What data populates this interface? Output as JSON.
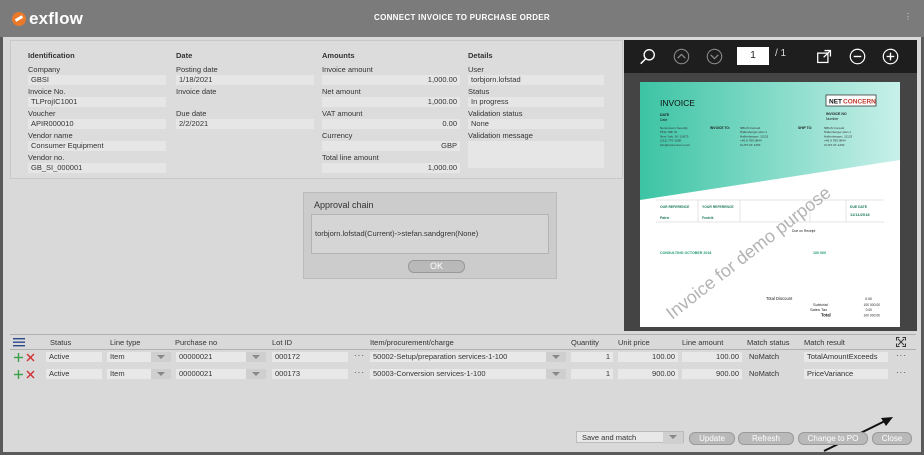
{
  "app": {
    "logo_text": "exflow",
    "title": "CONNECT INVOICE TO PURCHASE ORDER",
    "menu_glyph": "⋮"
  },
  "identification": {
    "header": "Identification",
    "company_label": "Company",
    "company": "GBSI",
    "invoice_no_label": "Invoice No.",
    "invoice_no": "TLProjIC1001",
    "voucher_label": "Voucher",
    "voucher": "APIR000010",
    "vendor_name_label": "Vendor name",
    "vendor_name": "Consumer Equipment",
    "vendor_no_label": "Vendor no.",
    "vendor_no": "GB_SI_000001"
  },
  "date": {
    "header": "Date",
    "posting_label": "Posting date",
    "posting": "1/18/2021",
    "invoice_label": "Invoice date",
    "invoice": "",
    "due_label": "Due date",
    "due": "2/2/2021"
  },
  "amounts": {
    "header": "Amounts",
    "invoice_amount_label": "Invoice amount",
    "invoice_amount": "1,000.00",
    "net_amount_label": "Net amount",
    "net_amount": "1,000.00",
    "vat_amount_label": "VAT amount",
    "vat_amount": "0.00",
    "currency_label": "Currency",
    "currency": "GBP",
    "total_line_label": "Total line amount",
    "total_line": "1,000.00"
  },
  "details": {
    "header": "Details",
    "user_label": "User",
    "user": "torbjorn.lofstad",
    "status_label": "Status",
    "status": "In progress",
    "validation_status_label": "Validation status",
    "validation_status": "None",
    "validation_message_label": "Validation message",
    "validation_message": ""
  },
  "approval": {
    "title": "Approval chain",
    "chain": "torbjorn.lofstad(Current)->stefan.sandgren(None)",
    "ok_label": "OK"
  },
  "viewer": {
    "page": "1",
    "page_total": "/ 1"
  },
  "invoice_doc": {
    "title": "INVOICE",
    "brand_a": "NET",
    "brand_b": "CONCERN",
    "invoice_no_label": "INVOICE NO",
    "number_label": "Number",
    "date_label": "DATE",
    "date_value": "Date",
    "from_lines": [
      "Netconcern Security",
      "55 E 78th St",
      "New York, NY 10075",
      "(212) 770-1288",
      "info@netconcern.com"
    ],
    "invoice_to_label": "INVOICE TO:",
    "invoice_to_lines": [
      "NBGS Consult",
      "Hallenberger plan 1",
      "Hallenbergen, 11123",
      "+46 8 789 0844",
      "CUST AT-1254"
    ],
    "ship_to_label": "SHIP TO:",
    "ship_to_lines": [
      "NBGS Consult",
      "Hallenberger plan 1",
      "Hallenbergen, 11123",
      "+46 8 789 0844",
      "CUST AT-1254"
    ],
    "our_ref_label": "OUR REFERENCE",
    "our_ref": "Patric",
    "your_ref_label": "YOUR REFERENCE",
    "your_ref": "Fredrik",
    "due_date_label": "DUE DATE",
    "due_date": "11/11/2018",
    "due_on_receipt": "Due on Receipt",
    "line_desc": "CONSULTING OCTOBER 2018",
    "line_amount": "100 000",
    "total_discount_label": "Total Discount",
    "total_discount": "0.00",
    "subtotal_label": "Subtotal",
    "subtotal": "100 000.00",
    "sales_tax_label": "Sales Tax",
    "sales_tax": "0.00",
    "total_label": "Total",
    "total": "100 000.00",
    "watermark": "Invoice for demo purpose"
  },
  "grid": {
    "headers": [
      "Status",
      "Line type",
      "Purchase no",
      "Lot ID",
      "Item/procurement/charge",
      "Quantity",
      "Unit price",
      "Line amount",
      "Match status",
      "Match result"
    ],
    "rows": [
      {
        "status": "Active",
        "line_type": "Item",
        "purchase_no": "00000021",
        "lot_id": "000172",
        "item": "50002-Setup/preparation services-1-100",
        "quantity": "1",
        "unit_price": "100.00",
        "line_amount": "100.00",
        "match_status": "NoMatch",
        "match_result": "TotalAmountExceeds"
      },
      {
        "status": "Active",
        "line_type": "Item",
        "purchase_no": "00000021",
        "lot_id": "000173",
        "item": "50003-Conversion services-1-100",
        "quantity": "1",
        "unit_price": "900.00",
        "line_amount": "900.00",
        "match_status": "NoMatch",
        "match_result": "PriceVariance"
      }
    ],
    "ellipsis": "···"
  },
  "footer": {
    "select_value": "Save and match",
    "update": "Update",
    "refresh": "Refresh",
    "change_po": "Change to PO",
    "close": "Close"
  },
  "colors": {
    "accent": "#e8792b",
    "add": "#3aa04a",
    "remove": "#d03030",
    "invoice_teal": "#3fc0a8"
  }
}
